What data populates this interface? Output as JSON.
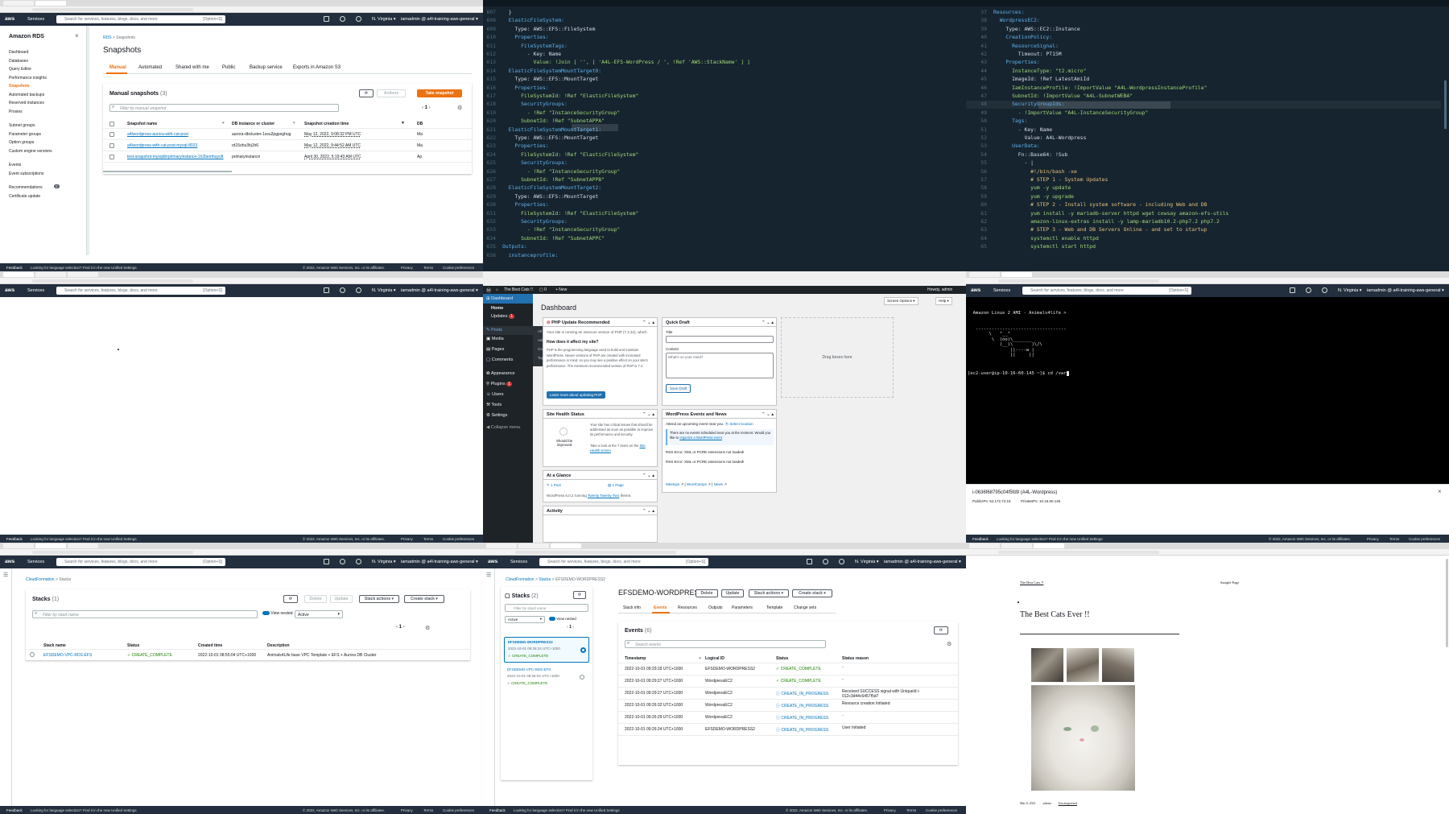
{
  "rds": {
    "sidebar_title": "Amazon RDS",
    "sidebar_groups": [
      [
        "Dashboard",
        "Databases",
        "Query Editor",
        "Performance insights",
        "Snapshots",
        "Automated backups",
        "Reserved instances",
        "Proxies"
      ],
      [
        "Subnet groups",
        "Parameter groups",
        "Option groups",
        "Custom engine versions"
      ],
      [
        "Events",
        "Event subscriptions"
      ],
      [
        "Recommendations",
        "Certificate update"
      ]
    ],
    "recommendations_count": "0",
    "breadcrumb": [
      "RDS",
      "Snapshots"
    ],
    "page_title": "Snapshots",
    "tabs": [
      "Manual",
      "Automated",
      "Shared with me",
      "Public",
      "Backup service",
      "Exports in Amazon S3"
    ],
    "table_title": "Manual snapshots",
    "table_count": "(3)",
    "actions_label": "Actions",
    "take_snapshot_label": "Take snapshot",
    "filter_placeholder": "Filter by manual snapshot",
    "page": "1",
    "columns": [
      "Snapshot name",
      "DB instance or cluster",
      "Snapshot creation time",
      "DB"
    ],
    "rows": [
      {
        "name": "a4lwordpress-aurora-with-cat-post",
        "db": "aurora-dbcluster-1ssu2pgpxghug",
        "time": "May 12, 2022, 9:08:32 PM UTC",
        "tail": "Ma"
      },
      {
        "name": "a4lwordpress-with-cat-post-mysql-8023",
        "db": "rd15ohs3hj1h6",
        "time": "May 12, 2022, 9:44:52 AM UTC",
        "tail": "Ma"
      },
      {
        "name": "test-snapshot-mysqldrrprimaryinstance-1h2bemhuyuft",
        "db": "primaryinstance",
        "time": "April 30, 2022, 5:19:43 AM UTC",
        "tail": "Ap"
      }
    ]
  },
  "aws_nav": {
    "services": "Services",
    "search_placeholder": "Search for services, features, blogs, docs, and more",
    "shortcut": "[Option+S]",
    "region": "N. Virginia ▾",
    "account": "iamadmin @ a4l-training-aws-general ▾"
  },
  "footer": {
    "feedback": "Feedback",
    "language": "Looking for language selection? Find it in the new Unified Settings",
    "copyright": "© 2022, Amazon Web Services, Inc. or its affiliates.",
    "privacy": "Privacy",
    "terms": "Terms",
    "cookies": "Cookie preferences"
  },
  "code1": [
    {
      "n": "607",
      "t": "  }"
    },
    {
      "n": "608",
      "t": "  ElasticFileSystem:"
    },
    {
      "n": "609",
      "t": "    Type: AWS::EFS::FileSystem"
    },
    {
      "n": "610",
      "t": "    Properties:"
    },
    {
      "n": "611",
      "t": "      FileSystemTags:"
    },
    {
      "n": "612",
      "t": "        - Key: Name"
    },
    {
      "n": "613",
      "t": "          Value: !Join [ '', [ 'A4L-EFS-WordPress / ', !Ref 'AWS::StackName' ] ]"
    },
    {
      "n": "614",
      "t": "  ElasticFileSystemMountTarget0:"
    },
    {
      "n": "615",
      "t": "    Type: AWS::EFS::MountTarget"
    },
    {
      "n": "616",
      "t": "    Properties:"
    },
    {
      "n": "617",
      "t": "      FileSystemId: !Ref \"ElasticFileSystem\""
    },
    {
      "n": "618",
      "t": "      SecurityGroups:"
    },
    {
      "n": "619",
      "t": "        - !Ref \"InstanceSecurityGroup\""
    },
    {
      "n": "620",
      "t": "      SubnetId: !Ref \"SubnetAPPA\""
    },
    {
      "n": "621",
      "t": "  ElasticFileSystemMountTarget1:"
    },
    {
      "n": "622",
      "t": "    Type: AWS::EFS::MountTarget"
    },
    {
      "n": "623",
      "t": "    Properties:"
    },
    {
      "n": "624",
      "t": "      FileSystemId: !Ref \"ElasticFileSystem\""
    },
    {
      "n": "625",
      "t": "      SecurityGroups:"
    },
    {
      "n": "626",
      "t": "        - !Ref \"InstanceSecurityGroup\""
    },
    {
      "n": "627",
      "t": "      SubnetId: !Ref \"SubnetAPPB\""
    },
    {
      "n": "628",
      "t": "  ElasticFileSystemMountTarget2:"
    },
    {
      "n": "629",
      "t": "    Type: AWS::EFS::MountTarget"
    },
    {
      "n": "630",
      "t": "    Properties:"
    },
    {
      "n": "631",
      "t": "      FileSystemId: !Ref \"ElasticFileSystem\""
    },
    {
      "n": "632",
      "t": "      SecurityGroups:"
    },
    {
      "n": "633",
      "t": "        - !Ref \"InstanceSecurityGroup\""
    },
    {
      "n": "634",
      "t": "      SubnetId: !Ref \"SubnetAPPC\""
    },
    {
      "n": "635",
      "t": "Outputs:"
    },
    {
      "n": "636",
      "t": "  instanceprofile:"
    }
  ],
  "code2": [
    {
      "n": "37",
      "t": "Resources:"
    },
    {
      "n": "38",
      "t": "  WordpressEC2:"
    },
    {
      "n": "39",
      "t": "    Type: AWS::EC2::Instance"
    },
    {
      "n": "40",
      "t": "    CreationPolicy:"
    },
    {
      "n": "41",
      "t": "      ResourceSignal:"
    },
    {
      "n": "42",
      "t": "        Timeout: PT15M"
    },
    {
      "n": "43",
      "t": "    Properties:"
    },
    {
      "n": "44",
      "t": "      InstanceType: \"t2.micro\""
    },
    {
      "n": "45",
      "t": "      ImageId: !Ref LatestAmiId"
    },
    {
      "n": "46",
      "t": "      IamInstanceProfile: !ImportValue \"A4L-WordpressInstanceProfile\""
    },
    {
      "n": "47",
      "t": "      SubnetId: !ImportValue \"A4L-SubnetWEBA\""
    },
    {
      "n": "48",
      "t": "      SecurityGroupIds:"
    },
    {
      "n": "49",
      "t": "        - !ImportValue \"A4L-InstanceSecurityGroup\""
    },
    {
      "n": "50",
      "t": "      Tags:"
    },
    {
      "n": "51",
      "t": "        - Key: Name"
    },
    {
      "n": "52",
      "t": "          Value: A4L-Wordpress"
    },
    {
      "n": "53",
      "t": "      UserData:"
    },
    {
      "n": "54",
      "t": "        Fn::Base64: !Sub"
    },
    {
      "n": "55",
      "t": "          - |"
    },
    {
      "n": "56",
      "t": "            #!/bin/bash -xe"
    },
    {
      "n": "57",
      "t": "            # STEP 1 - System Updates"
    },
    {
      "n": "58",
      "t": "            yum -y update"
    },
    {
      "n": "59",
      "t": "            yum -y upgrade"
    },
    {
      "n": "60",
      "t": "            # STEP 2 - Install system software - including Web and DB"
    },
    {
      "n": "61",
      "t": "            yum install -y mariadb-server httpd wget cowsay amazon-efs-utils"
    },
    {
      "n": "62",
      "t": "            amazon-linux-extras install -y lamp-mariadb10.2-php7.2 php7.2"
    },
    {
      "n": "63",
      "t": "            # STEP 3 - Web and DB Servers Online - and set to startup"
    },
    {
      "n": "64",
      "t": "            systemctl enable httpd"
    },
    {
      "n": "65",
      "t": "            systemctl start httpd"
    }
  ],
  "wp": {
    "site_name": "The Best Cats !!",
    "comments": "0",
    "new_label": "+ New",
    "howdy": "Howdy, admin",
    "screen_options": "Screen Options ▾",
    "help": "Help ▾",
    "menu": [
      "Dashboard",
      "Home",
      "Updates",
      "Posts",
      "Media",
      "Pages",
      "Comments",
      "Appearance",
      "Plugins",
      "Users",
      "Tools",
      "Settings",
      "Collapse menu"
    ],
    "updates_badge": "1",
    "plugins_badge": "1",
    "posts_flyout": [
      "All Posts",
      "Add New",
      "Categories",
      "Tags"
    ],
    "title": "Dashboard",
    "php_title": "PHP Update Recommended",
    "php_text1": "Your site is running an insecure version of PHP (7.2.34), which",
    "php_sub": "How does it affect my site?",
    "php_text2": "PHP is the programming language used to build and maintain WordPress. Newer versions of PHP are created with increased performance in mind, so you may see a positive effect on your site's performance. The minimum recommended version of PHP is 7.4.",
    "php_btn": "Learn more about updating PHP",
    "health_title": "Site Health Status",
    "health_status": "Should be improved",
    "health_text": "Your site has critical issues that should be addressed as soon as possible to improve its performance and security.",
    "health_link_pre": "Take a look at the 7 items on the",
    "health_link": "Site Health screen",
    "glance_title": "At a Glance",
    "glance_post": "1 Post",
    "glance_page": "1 Page",
    "glance_text": "WordPress 6.0.2 running",
    "glance_theme": "Twenty Twenty-Two",
    "glance_suffix": "theme.",
    "activity_title": "Activity",
    "qd_title": "Quick Draft",
    "qd_title_label": "Title",
    "qd_content_label": "Content",
    "qd_placeholder": "What's on your mind?",
    "qd_btn": "Save Draft",
    "events_title": "WordPress Events and News",
    "events_attend": "Attend an upcoming event near you.",
    "events_select": "Select location",
    "events_none": "There are no events scheduled near you at the moment. Would you like to",
    "events_org": "organize a WordPress event",
    "rss1": "RSS Error: XML or PCRE extensions not loaded!",
    "rss2": "RSS Error: XML or PCRE extensions not loaded!",
    "links": [
      "Meetups",
      "WordCamps",
      "News"
    ],
    "drag": "Drag boxes here"
  },
  "terminal": {
    "banner": "  Amazon Linux 2 AMI - Animals4life >",
    "cow": [
      "   ----------------------------------",
      "        \\   ^__^",
      "         \\  (oo)\\_______",
      "            (__)\\       )\\/\\",
      "                ||----w |",
      "                ||     ||"
    ],
    "prompt": "[ec2-user@ip-10-16-60-145 ~]$ cd /var",
    "instance_id": "i-0636f68795c04f5fd9 (A4L-Wordpress)",
    "public_ip": "PublicIPs: 54.172.74.15",
    "private_ip": "PrivateIPs: 10.16.60.145"
  },
  "cf1": {
    "breadcrumb": [
      "CloudFormation",
      "Stacks"
    ],
    "title": "Stacks",
    "count": "(1)",
    "buttons": [
      "Delete",
      "Update",
      "Stack actions ▾",
      "Create stack ▾"
    ],
    "filter_placeholder": "Filter by stack name",
    "view_nested": "View nested",
    "status_filter": "Active",
    "page": "1",
    "columns": [
      "Stack name",
      "Status",
      "Created time",
      "Description"
    ],
    "row": {
      "name": "EFSDEMO-VPC-RDS-EFS",
      "status": "CREATE_COMPLETE",
      "time": "2022-10-01 08:55:04 UTC+1000",
      "desc": "Animals4Life base VPC Template + EFS + Aurora DB Cluster"
    }
  },
  "cf2": {
    "breadcrumb": [
      "CloudFormation",
      "Stacks",
      "EFSDEMO-WORDPRESS2"
    ],
    "stacks_title": "Stacks",
    "stacks_count": "(2)",
    "filter_placeholder": "Filter by stack name",
    "status_filter": "Active",
    "view_nested": "View nested",
    "page": "1",
    "stacks": [
      {
        "name": "EFSDEMO-WORDPRESS2",
        "time": "2022-10-01 09:26:24 UTC+1000",
        "status": "CREATE_COMPLETE"
      },
      {
        "name": "EFSDEMO-VPC-RDS-EFS",
        "time": "2022-10-01 08:55:04 UTC+1000",
        "status": "CREATE_COMPLETE"
      }
    ],
    "detail_title": "EFSDEMO-WORDPRESS2",
    "detail_buttons": [
      "Delete",
      "Update",
      "Stack actions ▾",
      "Create stack ▾"
    ],
    "tabs": [
      "Stack info",
      "Events",
      "Resources",
      "Outputs",
      "Parameters",
      "Template",
      "Change sets"
    ],
    "events_title": "Events",
    "events_count": "(6)",
    "search_placeholder": "Search events",
    "columns": [
      "Timestamp",
      "Logical ID",
      "Status",
      "Status reason"
    ],
    "events": [
      {
        "time": "2022-10-01 09:29:29 UTC+1000",
        "id": "EFSDEMO-WORDPRESS2",
        "status": "CREATE_COMPLETE",
        "reason": "-"
      },
      {
        "time": "2022-10-01 09:29:27 UTC+1000",
        "id": "WordpressEC2",
        "status": "CREATE_COMPLETE",
        "reason": "-"
      },
      {
        "time": "2022-10-01 09:29:27 UTC+1000",
        "id": "WordpressEC2",
        "status": "CREATE_IN_PROGRESS",
        "reason": "Received SUCCESS signal with UniqueId i-012c3d44c6457f5d7"
      },
      {
        "time": "2022-10-01 09:26:32 UTC+1000",
        "id": "WordpressEC2",
        "status": "CREATE_IN_PROGRESS",
        "reason": "Resource creation Initiated"
      },
      {
        "time": "2022-10-01 09:26:29 UTC+1000",
        "id": "WordpressEC2",
        "status": "CREATE_IN_PROGRESS",
        "reason": "-"
      },
      {
        "time": "2022-10-01 09:26:24 UTC+1000",
        "id": "EFSDEMO-WORDPRESS2",
        "status": "CREATE_IN_PROGRESS",
        "reason": "User Initiated"
      }
    ]
  },
  "blog": {
    "site_link": "The Best Cats !!",
    "nav": "Sample Page",
    "title": "The Best Cats Ever !!",
    "date": "Mar 8, 2021",
    "author": "admin",
    "category": "Uncategorized"
  }
}
